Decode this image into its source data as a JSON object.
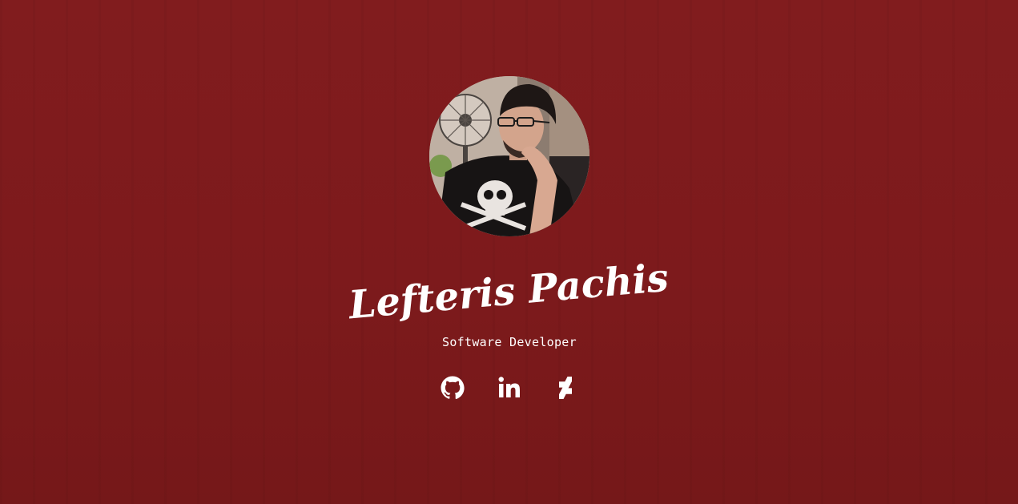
{
  "profile": {
    "name": "Lefteris Pachis",
    "title_prefix": "–",
    "title_suffix": "–",
    "role": "Software Developer"
  },
  "social_links": [
    {
      "icon": "github-icon",
      "name": "github"
    },
    {
      "icon": "linkedin-icon",
      "name": "linkedin"
    },
    {
      "icon": "deviantart-icon",
      "name": "deviantart"
    }
  ],
  "colors": {
    "background": "#7f1b1d",
    "text": "#ffffff"
  }
}
